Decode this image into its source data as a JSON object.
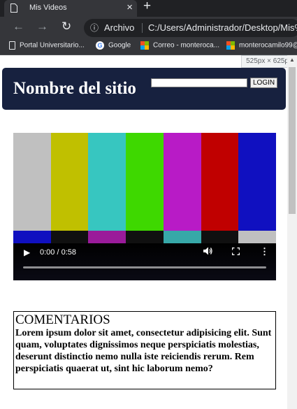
{
  "browser": {
    "tab_title": "Mis Videos",
    "tab_close": "×",
    "new_tab": "+",
    "address_chip": "Archivo",
    "url": "C:/Users/Administrador/Desktop/Mis%",
    "icons": {
      "back": "←",
      "forward": "→",
      "reload": "↻",
      "info": "ⓘ"
    }
  },
  "bookmarks": [
    {
      "label": "Portal Universitario...",
      "icon": "page-icon"
    },
    {
      "label": "Google",
      "icon": "google-icon"
    },
    {
      "label": "Correo - monteroca...",
      "icon": "microsoft-icon"
    },
    {
      "label": "monterocamilo99@",
      "icon": "microsoft-icon"
    }
  ],
  "viewport": {
    "size_badge": "525px × 625px"
  },
  "header": {
    "site_title": "Nombre del sitio",
    "search_value": "",
    "login_label": "LOGIN"
  },
  "video": {
    "time_label": "0:00 / 0:58",
    "progress": 0.0,
    "bar_colors": [
      "#c0c0c0",
      "#c0c000",
      "#37c6c0",
      "#3ed800",
      "#b81bc6",
      "#c00000",
      "#1010c0"
    ],
    "strip_colors": [
      "#1010c0",
      "#101010",
      "#9a1b9a",
      "#101010",
      "#37a8a8",
      "#101010",
      "#c0c0c0"
    ]
  },
  "comments": {
    "heading": "COMENTARIOS",
    "body": "Lorem ipsum dolor sit amet, consectetur adipisicing elit. Sunt quam, voluptates dignissimos neque perspiciatis molestias, deserunt distinctio nemo nulla iste reiciendis rerum. Rem perspiciatis quaerat ut, sint hic laborum nemo?"
  }
}
